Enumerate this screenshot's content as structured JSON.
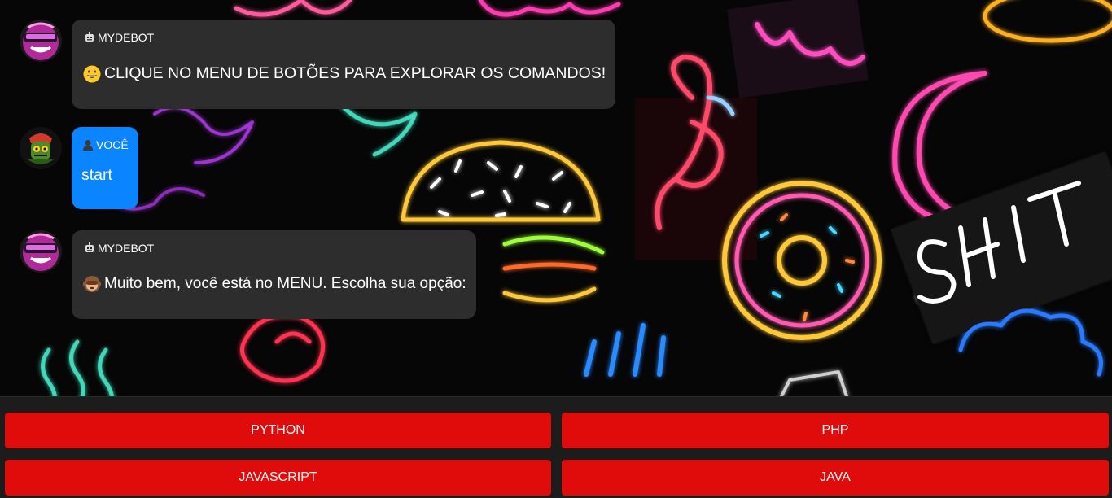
{
  "messages": [
    {
      "sender": "MYDEBOT",
      "sender_icon": "robot-icon",
      "emoji": "grinning-face-emoji",
      "text": "CLIQUE NO MENU DE BOTÕES PARA EXPLORAR OS COMANDOS!",
      "role": "bot"
    },
    {
      "sender": "VOCÊ",
      "sender_icon": "person-icon",
      "emoji": "",
      "text": "start",
      "role": "user"
    },
    {
      "sender": "MYDEBOT",
      "sender_icon": "robot-icon",
      "emoji": "monkey-emoji",
      "text": "Muito bem, você está no MENU. Escolha sua opção:",
      "role": "bot"
    }
  ],
  "menu": {
    "buttons": [
      "PYTHON",
      "PHP",
      "JAVASCRIPT",
      "JAVA"
    ]
  },
  "colors": {
    "bot_bubble": "#2d2d2d",
    "user_bubble": "#0a84ff",
    "button": "#e00b0b",
    "panel": "#1c1c1c"
  }
}
